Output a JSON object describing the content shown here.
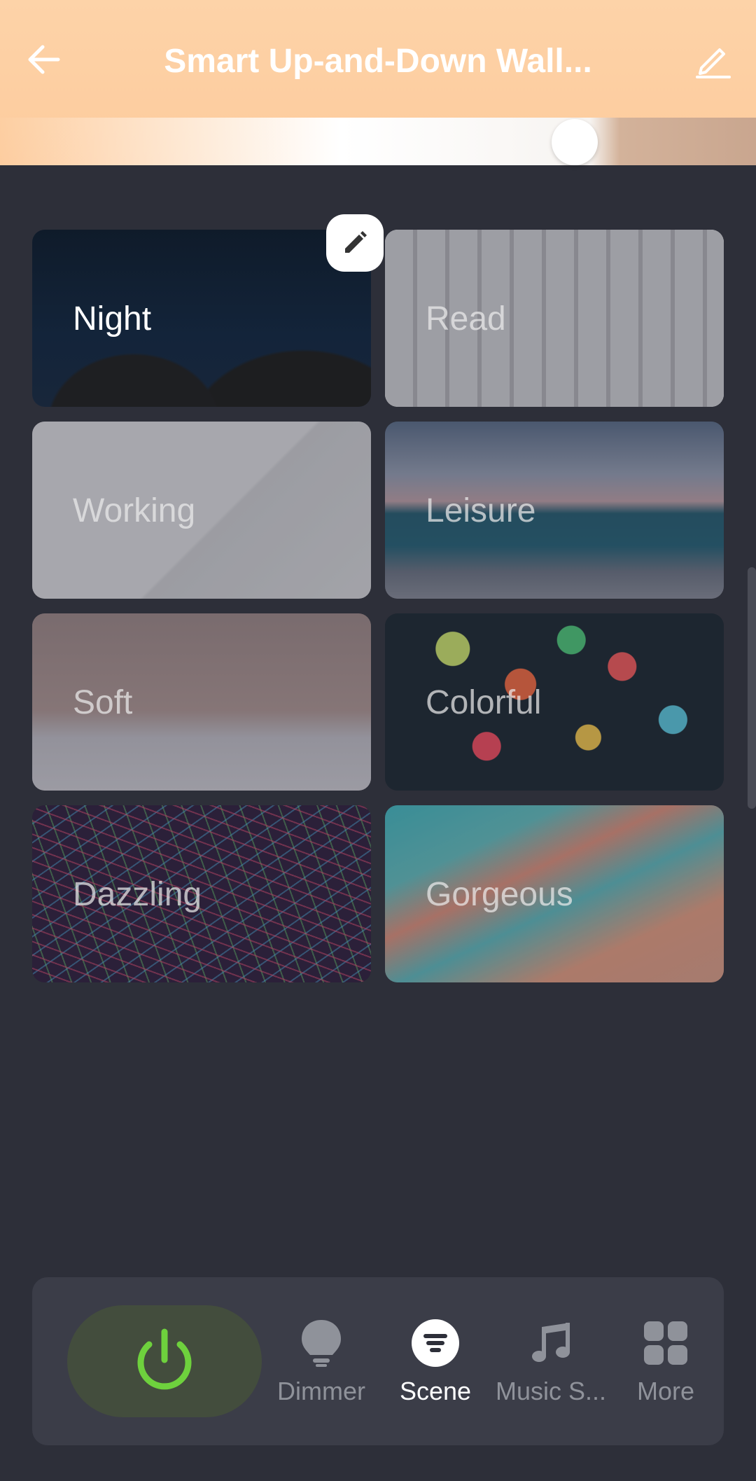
{
  "header": {
    "title": "Smart Up-and-Down Wall...",
    "brightness_level": 0.76,
    "colors": {
      "background": "#fdd3a8",
      "title": "#ffffff"
    }
  },
  "scenes": [
    {
      "label": "Night",
      "active": true
    },
    {
      "label": "Read",
      "active": false
    },
    {
      "label": "Working",
      "active": false
    },
    {
      "label": "Leisure",
      "active": false
    },
    {
      "label": "Soft",
      "active": false
    },
    {
      "label": "Colorful",
      "active": false
    },
    {
      "label": "Dazzling",
      "active": false
    },
    {
      "label": "Gorgeous",
      "active": false
    }
  ],
  "bottom_nav": {
    "power": {
      "icon": "power-icon",
      "color": "#6ed13d"
    },
    "items": [
      {
        "label": "Dimmer",
        "icon": "bulb-icon",
        "active": false
      },
      {
        "label": "Scene",
        "icon": "scene-icon",
        "active": true
      },
      {
        "label": "Music S...",
        "icon": "music-note-icon",
        "active": false
      },
      {
        "label": "More",
        "icon": "grid-icon",
        "active": false
      }
    ]
  },
  "colors": {
    "page_background": "#2d2f39",
    "accent_power": "#6ed13d",
    "nav_inactive": "#8f929a",
    "nav_active": "#ffffff"
  }
}
